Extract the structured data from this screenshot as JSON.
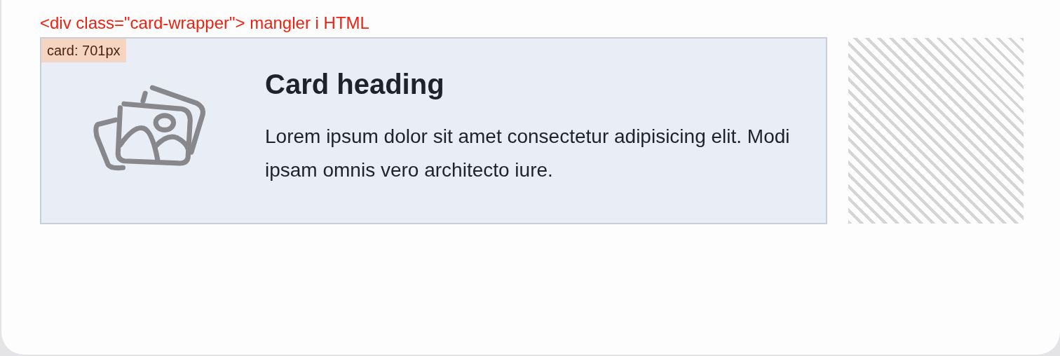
{
  "warning": "<div class=\"card-wrapper\"> mangler i HTML",
  "card": {
    "size_badge": "card: 701px",
    "heading": "Card heading",
    "body": "Lorem ipsum dolor sit amet consectetur adipisicing elit. Modi ipsam omnis vero architecto iure."
  }
}
